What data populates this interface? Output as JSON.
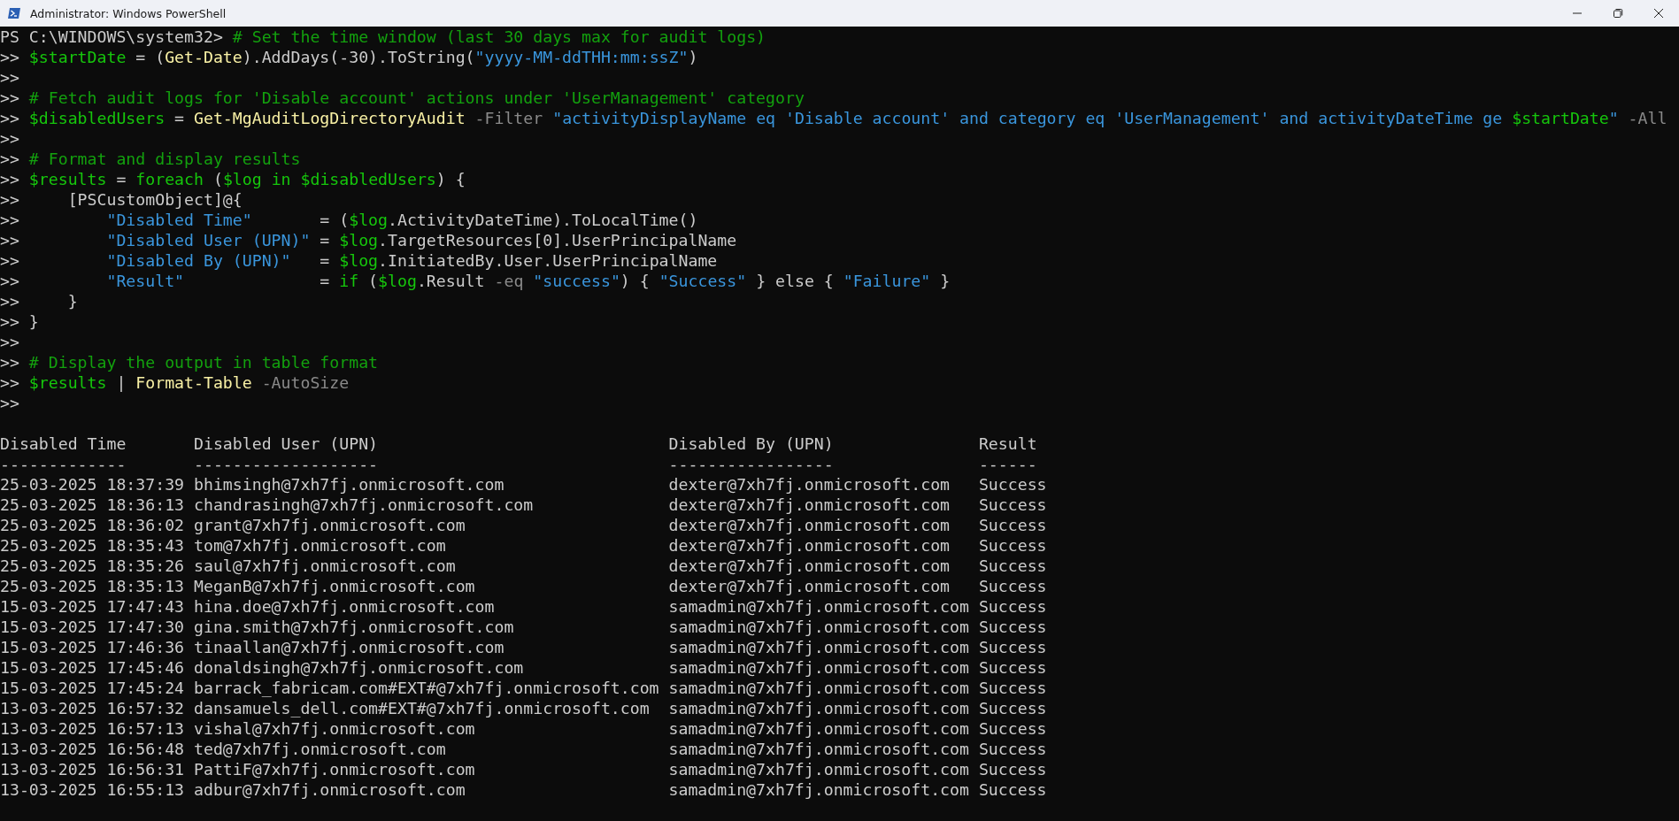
{
  "window": {
    "title": "Administrator: Windows PowerShell"
  },
  "console": {
    "lines": [
      {
        "prompt": "PS C:\\WINDOWS\\system32>",
        "tokens": [
          {
            "text": "# Set the time window (last 30 days max for audit logs)",
            "kind": "comment"
          }
        ]
      },
      {
        "prompt": ">>",
        "tokens": [
          {
            "text": "$startDate",
            "kind": "variable"
          },
          {
            "text": " = (",
            "kind": "plain"
          },
          {
            "text": "Get-Date",
            "kind": "command"
          },
          {
            "text": ").AddDays(-30).ToString(",
            "kind": "plain"
          },
          {
            "text": "\"yyyy-MM-ddTHH:mm:ssZ\"",
            "kind": "string"
          },
          {
            "text": ")",
            "kind": "plain"
          }
        ]
      },
      {
        "prompt": ">>"
      },
      {
        "prompt": ">>",
        "tokens": [
          {
            "text": "# Fetch audit logs for 'Disable account' actions under 'UserManagement' category",
            "kind": "comment"
          }
        ]
      },
      {
        "prompt": ">>",
        "tokens": [
          {
            "text": "$disabledUsers",
            "kind": "variable"
          },
          {
            "text": " = ",
            "kind": "plain"
          },
          {
            "text": "Get-MgAuditLogDirectoryAudit",
            "kind": "command"
          },
          {
            "text": " -Filter",
            "kind": "parameter"
          },
          {
            "text": " \"activityDisplayName eq 'Disable account' and category eq 'UserManagement' and activityDateTime ge ",
            "kind": "string"
          },
          {
            "text": "$startDate",
            "kind": "variable"
          },
          {
            "text": "\"",
            "kind": "string"
          },
          {
            "text": " -All",
            "kind": "parameter"
          }
        ]
      },
      {
        "prompt": ">>"
      },
      {
        "prompt": ">>",
        "tokens": [
          {
            "text": "# Format and display results",
            "kind": "comment"
          }
        ]
      },
      {
        "prompt": ">>",
        "tokens": [
          {
            "text": "$results",
            "kind": "variable"
          },
          {
            "text": " = ",
            "kind": "plain"
          },
          {
            "text": "foreach",
            "kind": "keyword"
          },
          {
            "text": " (",
            "kind": "plain"
          },
          {
            "text": "$log",
            "kind": "variable"
          },
          {
            "text": " in",
            "kind": "keyword"
          },
          {
            "text": " $disabledUsers",
            "kind": "variable"
          },
          {
            "text": ") {",
            "kind": "plain"
          }
        ]
      },
      {
        "prompt": ">>",
        "tokens": [
          {
            "text": "    [PSCustomObject]@{",
            "kind": "plain"
          }
        ]
      },
      {
        "prompt": ">>",
        "tokens": [
          {
            "text": "        \"Disabled Time\"",
            "kind": "string"
          },
          {
            "text": "       = (",
            "kind": "plain"
          },
          {
            "text": "$log",
            "kind": "variable"
          },
          {
            "text": ".ActivityDateTime).ToLocalTime()",
            "kind": "plain"
          }
        ]
      },
      {
        "prompt": ">>",
        "tokens": [
          {
            "text": "        \"Disabled User (UPN)\"",
            "kind": "string"
          },
          {
            "text": " = ",
            "kind": "plain"
          },
          {
            "text": "$log",
            "kind": "variable"
          },
          {
            "text": ".TargetResources[0].UserPrincipalName",
            "kind": "plain"
          }
        ]
      },
      {
        "prompt": ">>",
        "tokens": [
          {
            "text": "        \"Disabled By (UPN)\"",
            "kind": "string"
          },
          {
            "text": "   = ",
            "kind": "plain"
          },
          {
            "text": "$log",
            "kind": "variable"
          },
          {
            "text": ".InitiatedBy.User.UserPrincipalName",
            "kind": "plain"
          }
        ]
      },
      {
        "prompt": ">>",
        "tokens": [
          {
            "text": "        \"Result\"",
            "kind": "string"
          },
          {
            "text": "              = ",
            "kind": "plain"
          },
          {
            "text": "if",
            "kind": "keyword"
          },
          {
            "text": " (",
            "kind": "plain"
          },
          {
            "text": "$log",
            "kind": "variable"
          },
          {
            "text": ".Result ",
            "kind": "plain"
          },
          {
            "text": "-eq",
            "kind": "parameter"
          },
          {
            "text": " \"success\"",
            "kind": "string"
          },
          {
            "text": ") { ",
            "kind": "plain"
          },
          {
            "text": "\"Success\"",
            "kind": "string"
          },
          {
            "text": " } else { ",
            "kind": "plain"
          },
          {
            "text": "\"Failure\"",
            "kind": "string"
          },
          {
            "text": " }",
            "kind": "plain"
          }
        ]
      },
      {
        "prompt": ">>",
        "tokens": [
          {
            "text": "    }",
            "kind": "plain"
          }
        ]
      },
      {
        "prompt": ">>",
        "tokens": [
          {
            "text": "}",
            "kind": "plain"
          }
        ]
      },
      {
        "prompt": ">>"
      },
      {
        "prompt": ">>",
        "tokens": [
          {
            "text": "# Display the output in table format",
            "kind": "comment"
          }
        ]
      },
      {
        "prompt": ">>",
        "tokens": [
          {
            "text": "$results",
            "kind": "variable"
          },
          {
            "text": " | ",
            "kind": "plain"
          },
          {
            "text": "Format-Table",
            "kind": "command"
          },
          {
            "text": " -AutoSize",
            "kind": "parameter"
          }
        ]
      },
      {
        "prompt": ">>"
      }
    ],
    "table": {
      "columns": [
        {
          "header": "Disabled Time",
          "rule": "-------------"
        },
        {
          "header": "Disabled User (UPN)",
          "rule": "-------------------"
        },
        {
          "header": "Disabled By (UPN)",
          "rule": "-----------------"
        },
        {
          "header": "Result",
          "rule": "------"
        }
      ],
      "rows": [
        [
          "25-03-2025 18:37:39",
          "bhimsingh@7xh7fj.onmicrosoft.com",
          "dexter@7xh7fj.onmicrosoft.com",
          "Success"
        ],
        [
          "25-03-2025 18:36:13",
          "chandrasingh@7xh7fj.onmicrosoft.com",
          "dexter@7xh7fj.onmicrosoft.com",
          "Success"
        ],
        [
          "25-03-2025 18:36:02",
          "grant@7xh7fj.onmicrosoft.com",
          "dexter@7xh7fj.onmicrosoft.com",
          "Success"
        ],
        [
          "25-03-2025 18:35:43",
          "tom@7xh7fj.onmicrosoft.com",
          "dexter@7xh7fj.onmicrosoft.com",
          "Success"
        ],
        [
          "25-03-2025 18:35:26",
          "saul@7xh7fj.onmicrosoft.com",
          "dexter@7xh7fj.onmicrosoft.com",
          "Success"
        ],
        [
          "25-03-2025 18:35:13",
          "MeganB@7xh7fj.onmicrosoft.com",
          "dexter@7xh7fj.onmicrosoft.com",
          "Success"
        ],
        [
          "15-03-2025 17:47:43",
          "hina.doe@7xh7fj.onmicrosoft.com",
          "samadmin@7xh7fj.onmicrosoft.com",
          "Success"
        ],
        [
          "15-03-2025 17:47:30",
          "gina.smith@7xh7fj.onmicrosoft.com",
          "samadmin@7xh7fj.onmicrosoft.com",
          "Success"
        ],
        [
          "15-03-2025 17:46:36",
          "tinaallan@7xh7fj.onmicrosoft.com",
          "samadmin@7xh7fj.onmicrosoft.com",
          "Success"
        ],
        [
          "15-03-2025 17:45:46",
          "donaldsingh@7xh7fj.onmicrosoft.com",
          "samadmin@7xh7fj.onmicrosoft.com",
          "Success"
        ],
        [
          "15-03-2025 17:45:24",
          "barrack_fabricam.com#EXT#@7xh7fj.onmicrosoft.com",
          "samadmin@7xh7fj.onmicrosoft.com",
          "Success"
        ],
        [
          "13-03-2025 16:57:32",
          "dansamuels_dell.com#EXT#@7xh7fj.onmicrosoft.com",
          "samadmin@7xh7fj.onmicrosoft.com",
          "Success"
        ],
        [
          "13-03-2025 16:57:13",
          "vishal@7xh7fj.onmicrosoft.com",
          "samadmin@7xh7fj.onmicrosoft.com",
          "Success"
        ],
        [
          "13-03-2025 16:56:48",
          "ted@7xh7fj.onmicrosoft.com",
          "samadmin@7xh7fj.onmicrosoft.com",
          "Success"
        ],
        [
          "13-03-2025 16:56:31",
          "PattiF@7xh7fj.onmicrosoft.com",
          "samadmin@7xh7fj.onmicrosoft.com",
          "Success"
        ],
        [
          "13-03-2025 16:55:13",
          "adbur@7xh7fj.onmicrosoft.com",
          "samadmin@7xh7fj.onmicrosoft.com",
          "Success"
        ]
      ]
    }
  }
}
